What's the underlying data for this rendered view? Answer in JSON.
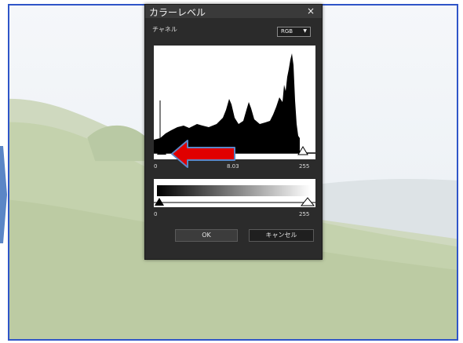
{
  "dialog": {
    "title": "カラーレベル",
    "close_icon": "close-icon",
    "channel_label": "チャネル",
    "channel_value": "RGB",
    "input_levels": {
      "black": "0",
      "mid": "8.03",
      "white": "255"
    },
    "output_levels": {
      "black": "0",
      "white": "255"
    },
    "ok_label": "OK",
    "cancel_label": "キャンセル"
  },
  "colors": {
    "accent_border": "#2f55c8",
    "dialog_bg": "#2b2b2b",
    "annotation_arrow": "#e00000"
  },
  "icons": [
    "close-icon",
    "dropdown-arrow-icon",
    "black-point-slider-icon",
    "white-point-slider-icon",
    "red-arrow-annotation"
  ]
}
